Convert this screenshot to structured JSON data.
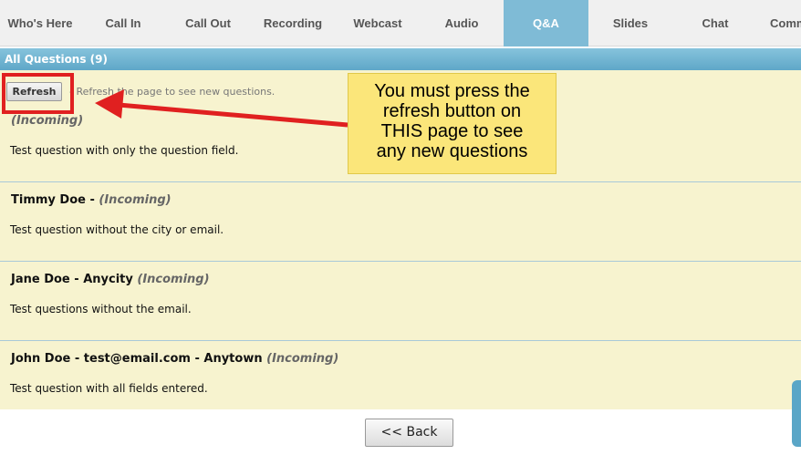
{
  "tabs": [
    {
      "label": "Who's Here",
      "active": false
    },
    {
      "label": "Call In",
      "active": false
    },
    {
      "label": "Call Out",
      "active": false
    },
    {
      "label": "Recording",
      "active": false
    },
    {
      "label": "Webcast",
      "active": false
    },
    {
      "label": "Audio",
      "active": false
    },
    {
      "label": "Q&A",
      "active": true
    },
    {
      "label": "Slides",
      "active": false
    },
    {
      "label": "Chat",
      "active": false
    },
    {
      "label": "Comm",
      "active": false
    }
  ],
  "questions_header": "All Questions (9)",
  "refresh": {
    "label": "Refresh",
    "hint": "- Refresh the page to see new questions."
  },
  "questions": [
    {
      "name": "",
      "status": "(Incoming)",
      "text": "Test question with only the question field."
    },
    {
      "name": "Timmy Doe - ",
      "status": "(Incoming)",
      "text": "Test question without the city or email."
    },
    {
      "name": "Jane Doe - Anycity ",
      "status": "(Incoming)",
      "text": "Test questions without the email."
    },
    {
      "name": "John Doe - test@email.com - Anytown ",
      "status": "(Incoming)",
      "text": "Test question with all fields entered."
    }
  ],
  "callout": "You must press the\nrefresh button on\nTHIS page to see\nany new questions",
  "back_button": "<< Back",
  "colors": {
    "active_tab": "#7fbbd6",
    "panel_bg": "#f7f3cf",
    "annotation_red": "#e02020",
    "callout_bg": "#fbe67a"
  }
}
